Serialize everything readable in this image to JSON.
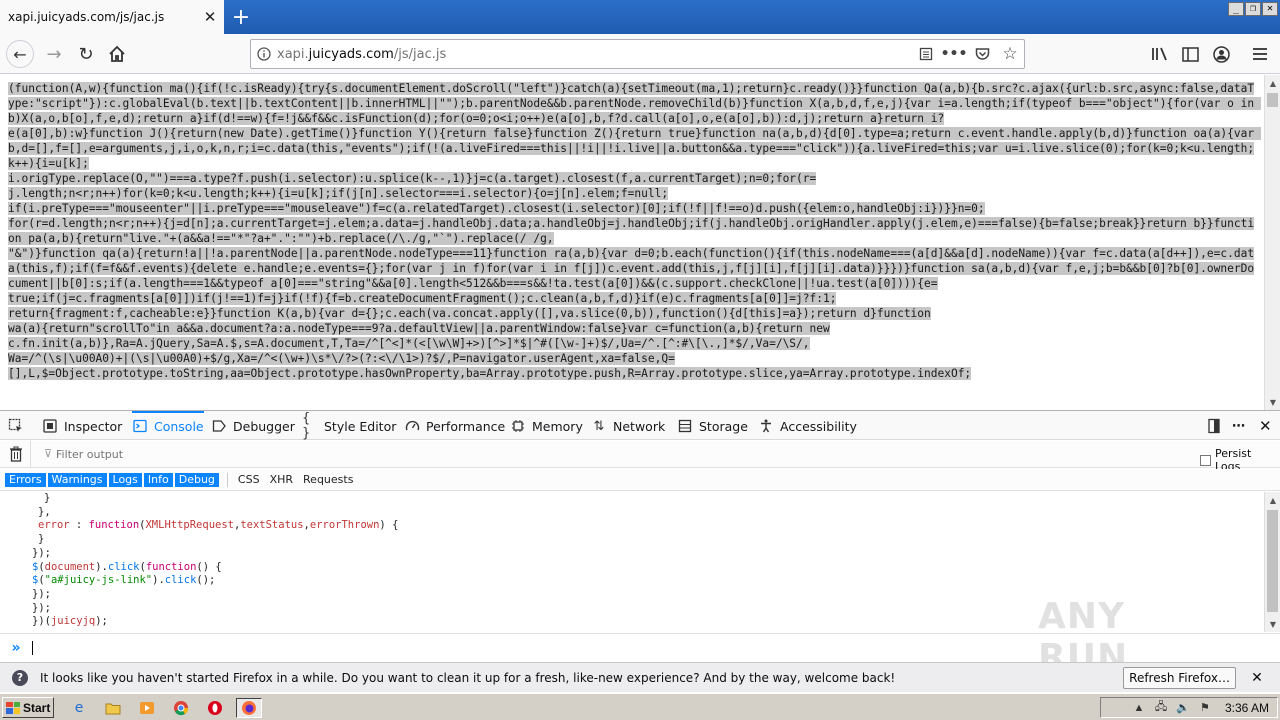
{
  "browser": {
    "tab_title": "xapi.juicyads.com/js/jac.js",
    "tab_close": "✕",
    "new_tab": "+",
    "url_prefix": "xapi.",
    "url_domain": "juicyads.com",
    "url_path": "/js/jac.js",
    "window_controls": [
      "_",
      "❐",
      "✕"
    ]
  },
  "page": {
    "code": "(function(A,w){function ma(){if(!c.isReady){try{s.documentElement.doScroll(\"left\")}catch(a){setTimeout(ma,1);return}c.ready()}}function Qa(a,b){b.src?c.ajax({url:b.src,async:false,dataType:\"script\"}):c.globalEval(b.text||b.textContent||b.innerHTML||\"\");b.parentNode&&b.parentNode.removeChild(b)}function X(a,b,d,f,e,j){var i=a.length;if(typeof b===\"object\"){for(var o in b)X(a,o,b[o],f,e,d);return a}if(d!==w){f=!j&&f&&c.isFunction(d);for(o=0;o<i;o++)e(a[o],b,f?d.call(a[o],o,e(a[o],b)):d,j);return a}return i?\ne(a[0],b):w}function J(){return(new Date).getTime()}function Y(){return false}function Z(){return true}function na(a,b,d){d[0].type=a;return c.event.handle.apply(b,d)}function oa(a){var b,d=[],f=[],e=arguments,j,i,o,k,n,r;i=c.data(this,\"events\");if(!(a.liveFired===this||!i||!i.live||a.button&&a.type===\"click\")){a.liveFired=this;var u=i.live.slice(0);for(k=0;k<u.length;k++){i=u[k];\ni.origType.replace(O,\"\")===a.type?f.push(i.selector):u.splice(k--,1)}j=c(a.target).closest(f,a.currentTarget);n=0;for(r=\nj.length;n<r;n++)for(k=0;k<u.length;k++){i=u[k];if(j[n].selector===i.selector){o=j[n].elem;f=null;\nif(i.preType===\"mouseenter\"||i.preType===\"mouseleave\")f=c(a.relatedTarget).closest(i.selector)[0];if(!f||f!==o)d.push({elem:o,handleObj:i})}}n=0;\nfor(r=d.length;n<r;n++){j=d[n];a.currentTarget=j.elem;a.data=j.handleObj.data;a.handleObj=j.handleObj;if(j.handleObj.origHandler.apply(j.elem,e)===false){b=false;break}}return b}}function pa(a,b){return\"live.\"+(a&&a!==\"*\"?a+\".\":\"\")+b.replace(/\\./g,\"`\").replace(/ /g,\n\"&\")}function qa(a){return!a||!a.parentNode||a.parentNode.nodeType===11}function ra(a,b){var d=0;b.each(function(){if(this.nodeName===(a[d]&&a[d].nodeName)){var f=c.data(a[d++]),e=c.data(this,f);if(f=f&&f.events){delete e.handle;e.events={};for(var j in f)for(var i in f[j])c.event.add(this,j,f[j][i],f[j][i].data)}}})}function sa(a,b,d){var f,e,j;b=b&&b[0]?b[0].ownerDocument||b[0]:s;if(a.length===1&&typeof a[0]===\"string\"&&a[0].length<512&&b===s&&!ta.test(a[0])&&(c.support.checkClone||!ua.test(a[0]))){e=\ntrue;if(j=c.fragments[a[0]])if(j!==1)f=j}if(!f){f=b.createDocumentFragment();c.clean(a,b,f,d)}if(e)c.fragments[a[0]]=j?f:1;\nreturn{fragment:f,cacheable:e}}function K(a,b){var d={};c.each(va.concat.apply([],va.slice(0,b)),function(){d[this]=a});return d}function\nwa(a){return\"scrollTo\"in a&&a.document?a:a.nodeType===9?a.defaultView||a.parentWindow:false}var c=function(a,b){return new\nc.fn.init(a,b)},Ra=A.jQuery,Sa=A.$,s=A.document,T,Ta=/^[^<]*(<[\\w\\W]+>)[^>]*$|^#([\\w-]+)$/,Ua=/^.[^:#\\[\\.,]*$/,Va=/\\S/,\nWa=/^(\\s|\\u00A0)+|(\\s|\\u00A0)+$/g,Xa=/^<(\\w+)\\s*\\/?>(?:<\\/\\1>)?$/,P=navigator.userAgent,xa=false,Q=\n[],L,$=Object.prototype.toString,aa=Object.prototype.hasOwnProperty,ba=Array.prototype.push,R=Array.prototype.slice,ya=Array.prototype.indexOf;"
  },
  "devtools": {
    "tabs": [
      "Inspector",
      "Console",
      "Debugger",
      "Style Editor",
      "Performance",
      "Memory",
      "Network",
      "Storage",
      "Accessibility"
    ],
    "filter_placeholder": "Filter output",
    "persist_logs": "Persist Logs",
    "categories_on": [
      "Errors",
      "Warnings",
      "Logs",
      "Info",
      "Debug"
    ],
    "categories_off": [
      "CSS",
      "XHR",
      "Requests"
    ],
    "console_lines": [
      {
        "indent": 2,
        "parts": [
          [
            "",
            "}"
          ]
        ]
      },
      {
        "indent": 1,
        "parts": [
          [
            "",
            "},"
          ]
        ]
      },
      {
        "indent": 1,
        "parts": [
          [
            "prm",
            "error"
          ],
          [
            "",
            " : "
          ],
          [
            "kw",
            "function"
          ],
          [
            "",
            "("
          ],
          [
            "prm",
            "XMLHttpRequest"
          ],
          [
            "",
            ","
          ],
          [
            "prm",
            "textStatus"
          ],
          [
            "",
            ","
          ],
          [
            "prm",
            "errorThrown"
          ],
          [
            "",
            ") {"
          ]
        ]
      },
      {
        "indent": 1,
        "parts": [
          [
            "",
            "}"
          ]
        ]
      },
      {
        "indent": 0,
        "parts": [
          [
            "",
            "});"
          ]
        ]
      },
      {
        "indent": 0,
        "parts": [
          [
            "fn",
            "$"
          ],
          [
            "",
            "("
          ],
          [
            "prm",
            "document"
          ],
          [
            "",
            ")."
          ],
          [
            "fn",
            "click"
          ],
          [
            "",
            "("
          ],
          [
            "kw",
            "function"
          ],
          [
            "",
            "() {"
          ]
        ]
      },
      {
        "indent": 0,
        "parts": [
          [
            "fn",
            "$"
          ],
          [
            "",
            "("
          ],
          [
            "str",
            "\"a#juicy-js-link\""
          ],
          [
            "",
            ")."
          ],
          [
            "fn",
            "click"
          ],
          [
            "",
            "();"
          ]
        ]
      },
      {
        "indent": 0,
        "parts": [
          [
            "",
            "});"
          ]
        ]
      },
      {
        "indent": 0,
        "parts": [
          [
            "",
            "});"
          ]
        ]
      },
      {
        "indent": 0,
        "parts": [
          [
            "",
            "})("
          ],
          [
            "prm",
            "juicyjq"
          ],
          [
            "",
            ");"
          ]
        ]
      }
    ],
    "prompt": "»"
  },
  "notification": {
    "text": "It looks like you haven't started Firefox in a while. Do you want to clean it up for a fresh, like-new experience? And by the way, welcome back!",
    "button": "Refresh Firefox…",
    "close": "✕"
  },
  "taskbar": {
    "start": "Start",
    "clock": "3:36 AM"
  },
  "watermark": "ANY RUN"
}
